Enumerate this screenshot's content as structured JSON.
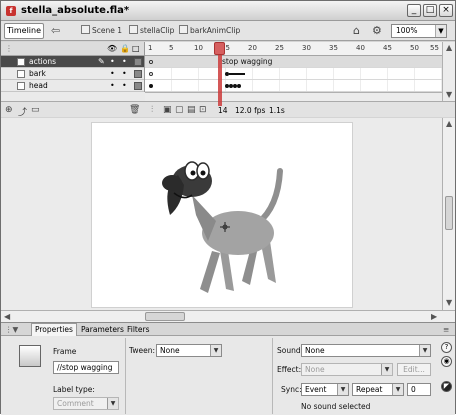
{
  "window": {
    "title": "stella_absolute.fla*",
    "app_icon": "flash-file-icon",
    "app_icon_letter": "f",
    "controls": {
      "minimize": "_",
      "maximize": "□",
      "close": "×"
    }
  },
  "nav": {
    "timeline_label": "Timeline",
    "breadcrumbs": [
      "Scene 1",
      "stellaClip",
      "barkAnimClip"
    ],
    "zoom": "100%"
  },
  "timeline": {
    "header_icons": {
      "eye": "eye-icon",
      "lock": "lock-icon",
      "outline": "outline-icon"
    },
    "ruler_ticks": [
      "1",
      "5",
      "10",
      "15",
      "20",
      "25",
      "30",
      "35",
      "40",
      "45",
      "50",
      "55"
    ],
    "layers": [
      {
        "name": "actions",
        "selected": true
      },
      {
        "name": "bark",
        "selected": false
      },
      {
        "name": "head",
        "selected": false
      }
    ],
    "frame_label": "stop wagging",
    "current_frame": "14",
    "fps": "12.0 fps",
    "elapsed": "1.1s"
  },
  "properties": {
    "tabs": [
      "Properties",
      "Parameters",
      "Filters"
    ],
    "frame_heading": "Frame",
    "frame_name_value": "//stop wagging",
    "label_type_label": "Label type:",
    "label_type_value": "Comment",
    "tween_label": "Tween:",
    "tween_value": "None",
    "sound_label": "Sound:",
    "sound_value": "None",
    "effect_label": "Effect:",
    "effect_value": "None",
    "edit_button": "Edit...",
    "sync_label": "Sync:",
    "sync_value": "Event",
    "repeat_value": "Repeat",
    "repeat_count": "0",
    "sound_status": "No sound selected"
  },
  "colors": {
    "dog_body": "#a3a3a3",
    "dog_dark": "#2b2b2b",
    "selected_layer": "#4a4a4a",
    "playhead": "#cc3b3b"
  }
}
